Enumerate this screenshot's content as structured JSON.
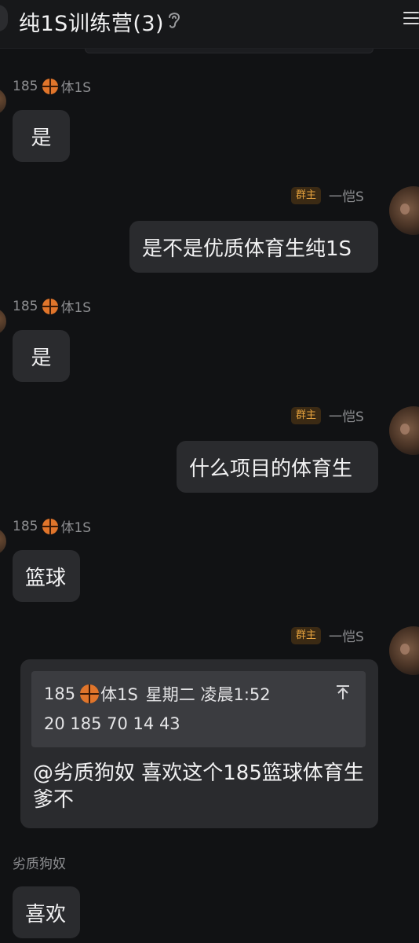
{
  "header": {
    "title": "纯1S训练营(3)"
  },
  "messages": [
    {
      "sender": "185",
      "sender_tag": "体1S",
      "text": "是"
    },
    {
      "sender": "一恺S",
      "badge": "群主",
      "text": "是不是优质体育生纯1S"
    },
    {
      "sender": "185",
      "sender_tag": "体1S",
      "text": "是"
    },
    {
      "sender": "一恺S",
      "badge": "群主",
      "text": "什么项目的体育生"
    },
    {
      "sender": "185",
      "sender_tag": "体1S",
      "text": "篮球"
    },
    {
      "sender": "一恺S",
      "badge": "群主",
      "quote": {
        "author": "185",
        "author_tag": "体1S",
        "time": "星期二 凌晨1:52",
        "text": "20 185 70 14 43"
      },
      "text": "@劣质狗奴 喜欢这个185篮球体育生爹不"
    },
    {
      "sender": "劣质狗奴",
      "text": "喜欢"
    }
  ],
  "icons": {
    "ear": "ear-icon",
    "menu": "menu-icon",
    "basketball": "basketball-emoji",
    "quote_jump": "arrow-up-icon"
  },
  "colors": {
    "background": "#111214",
    "bubble": "#2a2b2e",
    "owner_badge_bg": "#3b2a14",
    "owner_badge_text": "#e7a33e",
    "basketball": "#e0752b"
  }
}
